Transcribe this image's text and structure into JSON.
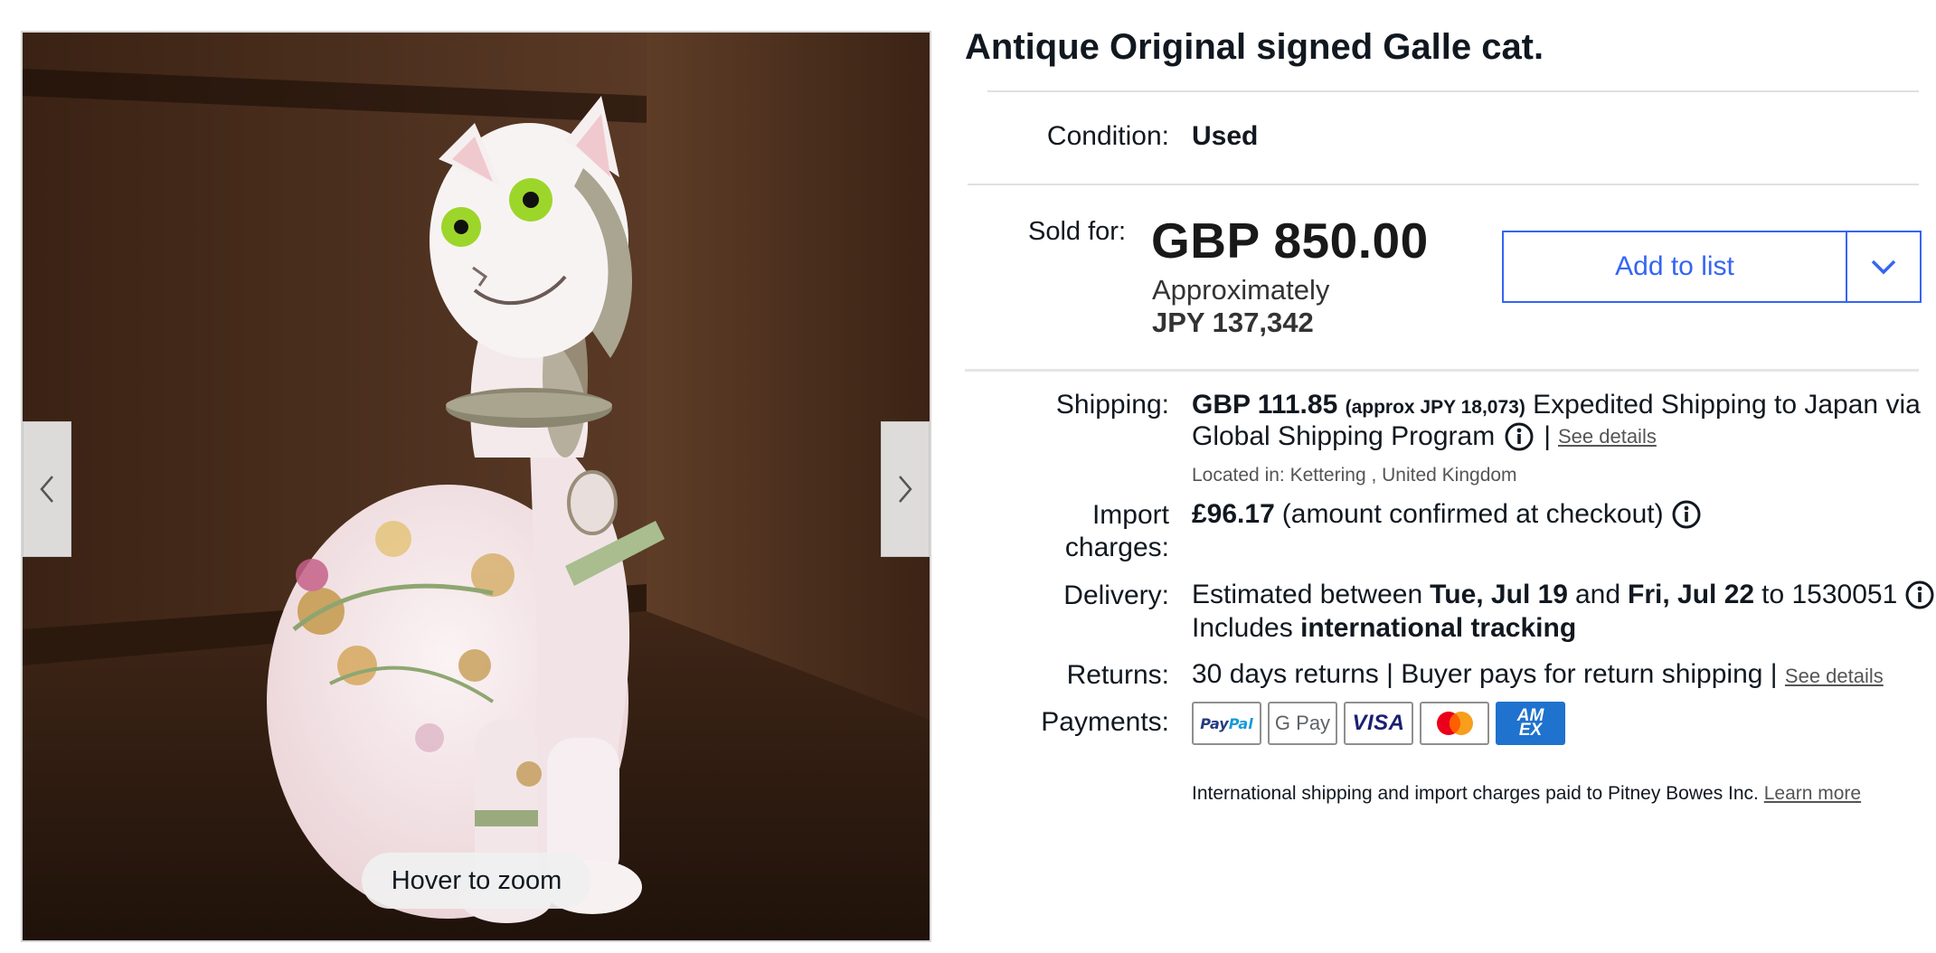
{
  "gallery": {
    "zoom_hint": "Hover to zoom",
    "prev_icon": "chevron-left-icon",
    "next_icon": "chevron-right-icon"
  },
  "listing": {
    "title": "Antique Original signed Galle cat."
  },
  "condition": {
    "label": "Condition:",
    "value": "Used"
  },
  "price": {
    "label": "Sold for:",
    "value": "GBP 850.00",
    "approx_label": "Approximately",
    "approx_value": "JPY 137,342"
  },
  "add_to_list": {
    "label": "Add to list",
    "dropdown_icon": "chevron-down-icon"
  },
  "shipping": {
    "label": "Shipping:",
    "price": "GBP 111.85",
    "approx": "(approx JPY 18,073)",
    "method": "Expedited Shipping to Japan via",
    "program": "Global Shipping Program",
    "separator": "|",
    "see_details": "See details",
    "located": "Located in: Kettering , United Kingdom"
  },
  "import": {
    "label_line1": "Import",
    "label_line2": "charges:",
    "amount": "£96.17",
    "note": "(amount confirmed at checkout)"
  },
  "delivery": {
    "label": "Delivery:",
    "prefix": "Estimated between",
    "date_from": "Tue, Jul 19",
    "and": "and",
    "date_to": "Fri, Jul 22",
    "to_zip": "to 1530051",
    "includes": "Includes",
    "tracking": "international tracking"
  },
  "returns": {
    "label": "Returns:",
    "text": "30 days returns | Buyer pays for return shipping |",
    "see_details": "See details"
  },
  "payments": {
    "label": "Payments:",
    "methods": [
      "PayPal",
      "G Pay",
      "VISA",
      "Mastercard",
      "AMEX"
    ],
    "paypal_a": "Pay",
    "paypal_b": "Pal",
    "gpay": "G Pay",
    "visa": "VISA",
    "amex_a": "AM",
    "amex_b": "EX"
  },
  "intl_note": {
    "text": "International shipping and import charges paid to Pitney Bowes Inc.",
    "learn_more": "Learn more"
  },
  "colors": {
    "accent_blue": "#3665f3",
    "text": "#111820",
    "muted": "#555555"
  }
}
